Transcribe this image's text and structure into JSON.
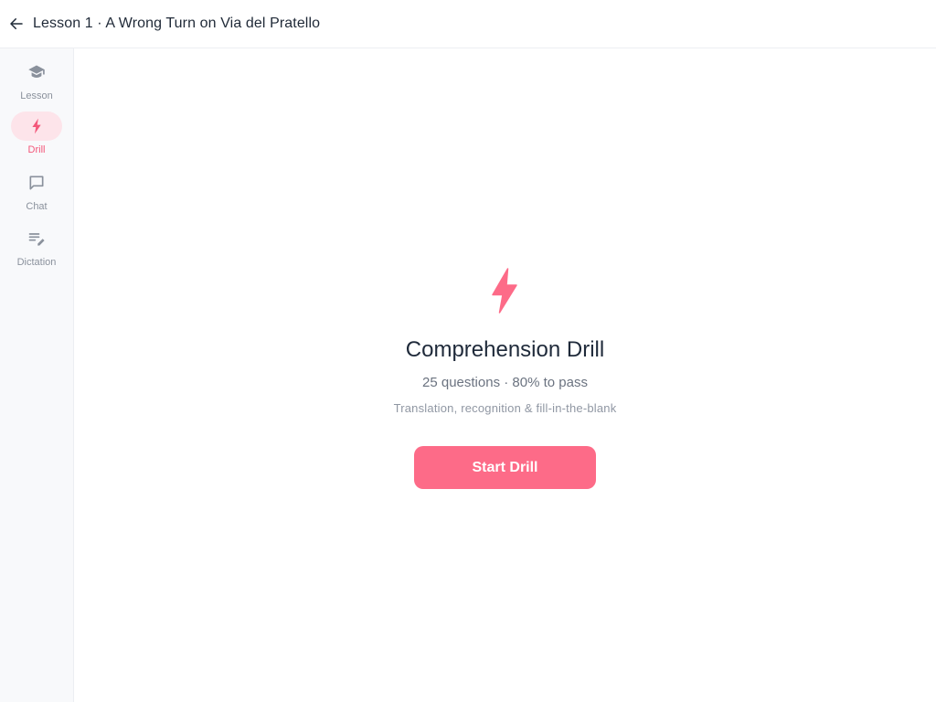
{
  "header": {
    "title": "Lesson 1 · A Wrong Turn on Via del Pratello",
    "back_icon": "arrow-left-icon"
  },
  "sidebar": {
    "items": [
      {
        "label": "Lesson",
        "icon": "graduation-cap-icon",
        "active": false
      },
      {
        "label": "Drill",
        "icon": "lightning-bolt-icon",
        "active": true
      },
      {
        "label": "Chat",
        "icon": "chat-bubble-icon",
        "active": false
      },
      {
        "label": "Dictation",
        "icon": "dictation-edit-icon",
        "active": false
      }
    ]
  },
  "drill": {
    "icon": "lightning-bolt-icon",
    "title": "Comprehension Drill",
    "meta": "25 questions · 80% to pass",
    "subtitle": "Translation, recognition & fill-in-the-blank",
    "start_label": "Start Drill"
  },
  "colors": {
    "accent": "#fd6b88",
    "accent_soft": "#fde4ea",
    "text_primary": "#1f2a3a",
    "text_muted": "#8a919c"
  }
}
